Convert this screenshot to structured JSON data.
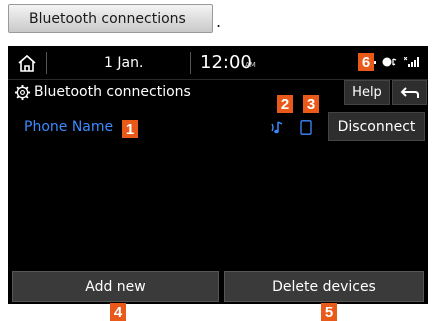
{
  "top_button": {
    "label": "Bluetooth connections",
    "suffix": "."
  },
  "status_bar": {
    "date": "1  Jan.",
    "time": "12:00",
    "ampm": "AM",
    "icons": [
      "battery-icon",
      "bluetooth-audio-icon",
      "signal-icon"
    ]
  },
  "header": {
    "title": "Bluetooth connections",
    "help_label": "Help"
  },
  "device": {
    "name": "Phone Name",
    "disconnect_label": "Disconnect"
  },
  "footer": {
    "add_new_label": "Add new",
    "delete_label": "Delete devices"
  },
  "callouts": [
    "1",
    "2",
    "3",
    "4",
    "5",
    "6"
  ],
  "colors": {
    "accent_blue": "#3d8bff",
    "callout_orange": "#e8591a",
    "screen_bg": "#000000"
  }
}
